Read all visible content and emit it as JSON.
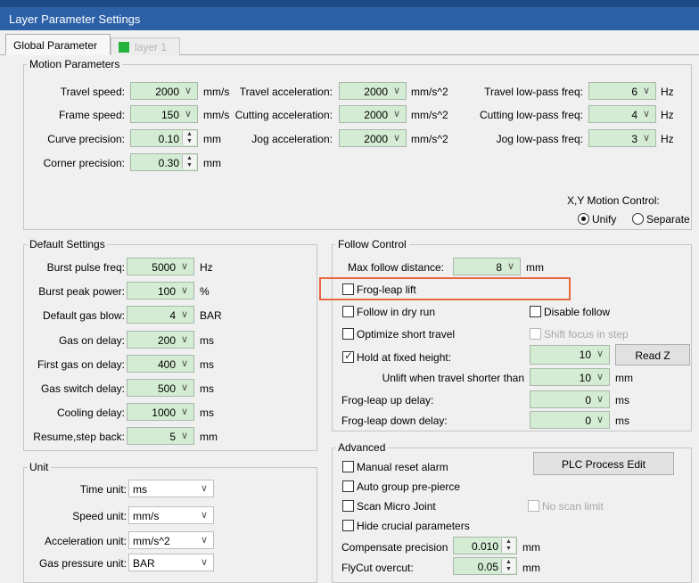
{
  "window": {
    "title": "Layer Parameter Settings"
  },
  "tabs": [
    {
      "label": "Global Parameter"
    },
    {
      "label": "layer 1",
      "swatch": "#23b23a"
    }
  ],
  "motion": {
    "title": "Motion Parameters",
    "travel_speed": {
      "label": "Travel speed:",
      "value": "2000",
      "unit": "mm/s"
    },
    "frame_speed": {
      "label": "Frame speed:",
      "value": "150",
      "unit": "mm/s"
    },
    "curve_precision": {
      "label": "Curve precision:",
      "value": "0.10",
      "unit": "mm"
    },
    "corner_precision": {
      "label": "Corner precision:",
      "value": "0.30",
      "unit": "mm"
    },
    "travel_accel": {
      "label": "Travel acceleration:",
      "value": "2000",
      "unit": "mm/s^2"
    },
    "cutting_accel": {
      "label": "Cutting acceleration:",
      "value": "2000",
      "unit": "mm/s^2"
    },
    "jog_accel": {
      "label": "Jog acceleration:",
      "value": "2000",
      "unit": "mm/s^2"
    },
    "travel_lowpass": {
      "label": "Travel low-pass freq:",
      "value": "6",
      "unit": "Hz"
    },
    "cutting_lowpass": {
      "label": "Cutting low-pass freq:",
      "value": "4",
      "unit": "Hz"
    },
    "jog_lowpass": {
      "label": "Jog low-pass freq:",
      "value": "3",
      "unit": "Hz"
    },
    "xy_control": {
      "label": "X,Y Motion Control:",
      "unify": "Unify",
      "separate": "Separate",
      "selected": "Unify"
    }
  },
  "defaults": {
    "title": "Default Settings",
    "burst_pulse_freq": {
      "label": "Burst pulse freq:",
      "value": "5000",
      "unit": "Hz"
    },
    "burst_peak_power": {
      "label": "Burst peak power:",
      "value": "100",
      "unit": "%"
    },
    "default_gas_blow": {
      "label": "Default gas blow:",
      "value": "4",
      "unit": "BAR"
    },
    "gas_on_delay": {
      "label": "Gas on delay:",
      "value": "200",
      "unit": "ms"
    },
    "first_gas_on_delay": {
      "label": "First gas on delay:",
      "value": "400",
      "unit": "ms"
    },
    "gas_switch_delay": {
      "label": "Gas switch delay:",
      "value": "500",
      "unit": "ms"
    },
    "cooling_delay": {
      "label": "Cooling delay:",
      "value": "1000",
      "unit": "ms"
    },
    "resume_step_back": {
      "label": "Resume,step back:",
      "value": "5",
      "unit": "mm"
    }
  },
  "unit": {
    "title": "Unit",
    "time": {
      "label": "Time unit:",
      "value": "ms"
    },
    "speed": {
      "label": "Speed unit:",
      "value": "mm/s"
    },
    "acceleration": {
      "label": "Acceleration unit:",
      "value": "mm/s^2"
    },
    "gas_pressure": {
      "label": "Gas pressure unit:",
      "value": "BAR"
    }
  },
  "follow": {
    "title": "Follow Control",
    "max_follow_distance": {
      "label": "Max follow distance:",
      "value": "8",
      "unit": "mm"
    },
    "frog_leap_lift": {
      "label": "Frog-leap lift",
      "checked": false
    },
    "follow_in_dry_run": {
      "label": "Follow in dry run",
      "checked": false
    },
    "disable_follow": {
      "label": "Disable follow",
      "checked": false
    },
    "optimize_short_travel": {
      "label": "Optimize short travel",
      "checked": false
    },
    "shift_focus_in_step": {
      "label": "Shift focus in step",
      "checked": false,
      "disabled": true
    },
    "hold_at_fixed_height": {
      "label": "Hold at fixed height:",
      "checked": true,
      "value": "10"
    },
    "read_z": "Read Z",
    "unlift_shorter": {
      "label": "Unlift when travel shorter than",
      "value": "10",
      "unit": "mm"
    },
    "frog_leap_up_delay": {
      "label": "Frog-leap up delay:",
      "value": "0",
      "unit": "ms"
    },
    "frog_leap_down_delay": {
      "label": "Frog-leap down delay:",
      "value": "0",
      "unit": "ms"
    },
    "highlight_color": "#e8673f"
  },
  "advanced": {
    "title": "Advanced",
    "plc_process_edit": "PLC Process Edit",
    "manual_reset_alarm": {
      "label": "Manual reset alarm",
      "checked": false
    },
    "auto_group_pre_pierce": {
      "label": "Auto group pre-pierce",
      "checked": false
    },
    "scan_micro_joint": {
      "label": "Scan Micro Joint",
      "checked": false
    },
    "no_scan_limit": {
      "label": "No scan limit",
      "checked": false,
      "disabled": true
    },
    "hide_crucial_parameters": {
      "label": "Hide crucial parameters",
      "checked": false
    },
    "compensate_precision": {
      "label": "Compensate precision",
      "value": "0.010",
      "unit": "mm"
    },
    "flycut_overcut": {
      "label": "FlyCut overcut:",
      "value": "0.05",
      "unit": "mm"
    }
  }
}
